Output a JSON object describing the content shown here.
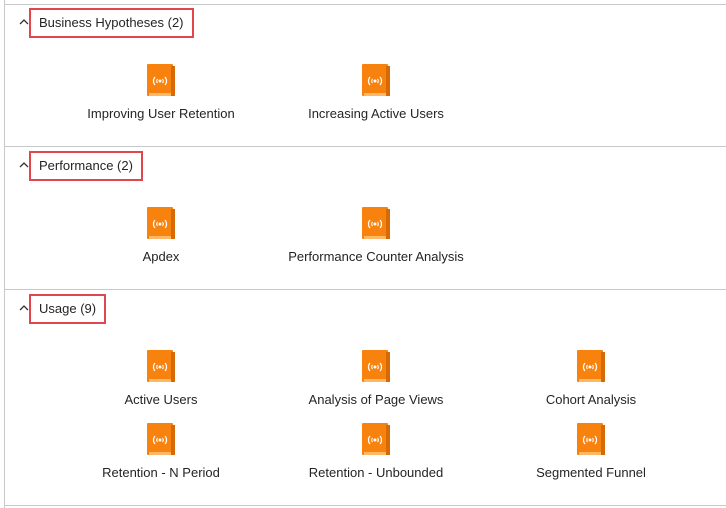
{
  "sections": [
    {
      "title": "Business Hypotheses (2)",
      "items": [
        {
          "label": "Improving User Retention",
          "icon": "workbook-icon"
        },
        {
          "label": "Increasing Active Users",
          "icon": "workbook-icon"
        }
      ]
    },
    {
      "title": "Performance (2)",
      "items": [
        {
          "label": "Apdex",
          "icon": "workbook-icon"
        },
        {
          "label": "Performance Counter Analysis",
          "icon": "workbook-icon"
        }
      ]
    },
    {
      "title": "Usage (9)",
      "items": [
        {
          "label": "Active Users",
          "icon": "workbook-icon"
        },
        {
          "label": "Analysis of Page Views",
          "icon": "workbook-icon"
        },
        {
          "label": "Cohort Analysis",
          "icon": "workbook-icon"
        },
        {
          "label": "Retention - N Period",
          "icon": "workbook-icon"
        },
        {
          "label": "Retention - Unbounded",
          "icon": "workbook-icon"
        },
        {
          "label": "Segmented Funnel",
          "icon": "workbook-icon"
        }
      ]
    }
  ],
  "colors": {
    "icon_orange": "#f7820e",
    "icon_dark": "#d86a05",
    "highlight_border": "#e0474c",
    "divider": "#c8c8c8"
  }
}
